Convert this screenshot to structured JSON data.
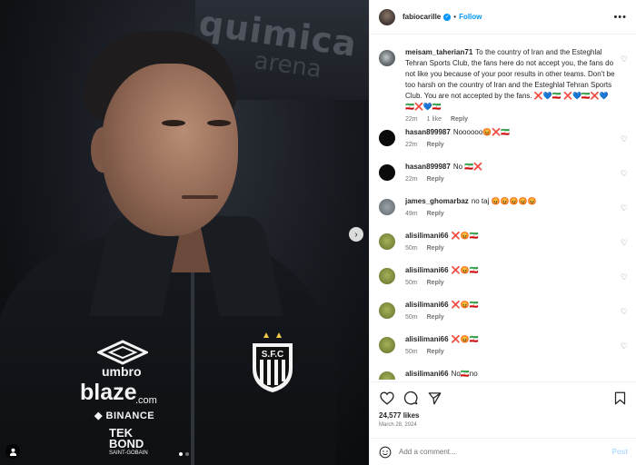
{
  "post": {
    "author": "fabiocarille",
    "separator": "•",
    "follow_label": "Follow",
    "more_label": "•••",
    "verified_mark": "✓"
  },
  "photo": {
    "banner_line1": "quimica",
    "banner_line2": "arena",
    "sponsors": {
      "umbro": "umbro",
      "blaze": "blaze",
      "blaze_suffix": ".com",
      "binance": "◆ BINANCE",
      "tek": "TEK",
      "bond": "BOND",
      "saint_gobain": "SAINT-GOBAIN"
    },
    "crest_text": "S.F.C",
    "next_icon": "›",
    "slide_count": 2,
    "active_slide": 1
  },
  "comments": [
    {
      "user": "meisam_taherian71",
      "avatar": "multi",
      "text": "To the country of Iran and the Esteghlal Tehran Sports Club, the fans here do not accept you, the fans do not like you because of your poor results in other teams. Don't be too harsh on the country of Iran and the Esteghlal Tehran Sports Club. You are not accepted by the fans. ❌💙🇮🇷 ❌💙🇮🇷❌💙🇮🇷❌💙🇮🇷",
      "time": "22m",
      "likes": "1 like",
      "reply": "Reply"
    },
    {
      "user": "hasan899987",
      "avatar": "black",
      "text": "Noooooo😡❌🇮🇷",
      "time": "22m",
      "likes": "",
      "reply": "Reply"
    },
    {
      "user": "hasan899987",
      "avatar": "black",
      "text": "No 🇮🇷❌",
      "time": "22m",
      "likes": "",
      "reply": "Reply"
    },
    {
      "user": "james_ghomarbaz",
      "avatar": "gray",
      "text": "no taj 😡😡😡😡😡",
      "time": "49m",
      "likes": "",
      "reply": "Reply"
    },
    {
      "user": "alisilimani66",
      "avatar": "green",
      "text": "❌😡🇮🇷",
      "time": "50m",
      "likes": "",
      "reply": "Reply"
    },
    {
      "user": "alisilimani66",
      "avatar": "green",
      "text": "❌😡🇮🇷",
      "time": "50m",
      "likes": "",
      "reply": "Reply"
    },
    {
      "user": "alisilimani66",
      "avatar": "green",
      "text": "❌😡🇮🇷",
      "time": "50m",
      "likes": "",
      "reply": "Reply"
    },
    {
      "user": "alisilimani66",
      "avatar": "green",
      "text": "❌😡🇮🇷",
      "time": "50m",
      "likes": "",
      "reply": "Reply"
    },
    {
      "user": "alisilimani66",
      "avatar": "green",
      "text": "No🇮🇷no",
      "time": "",
      "likes": "",
      "reply": ""
    }
  ],
  "actions": {
    "likes_text": "24,577 likes",
    "date_text": "March 28, 2024"
  },
  "composer": {
    "placeholder": "Add a comment...",
    "post_label": "Post"
  },
  "colors": {
    "accent": "#0095f6",
    "post_disabled": "#b3dbff",
    "muted": "#737373"
  }
}
